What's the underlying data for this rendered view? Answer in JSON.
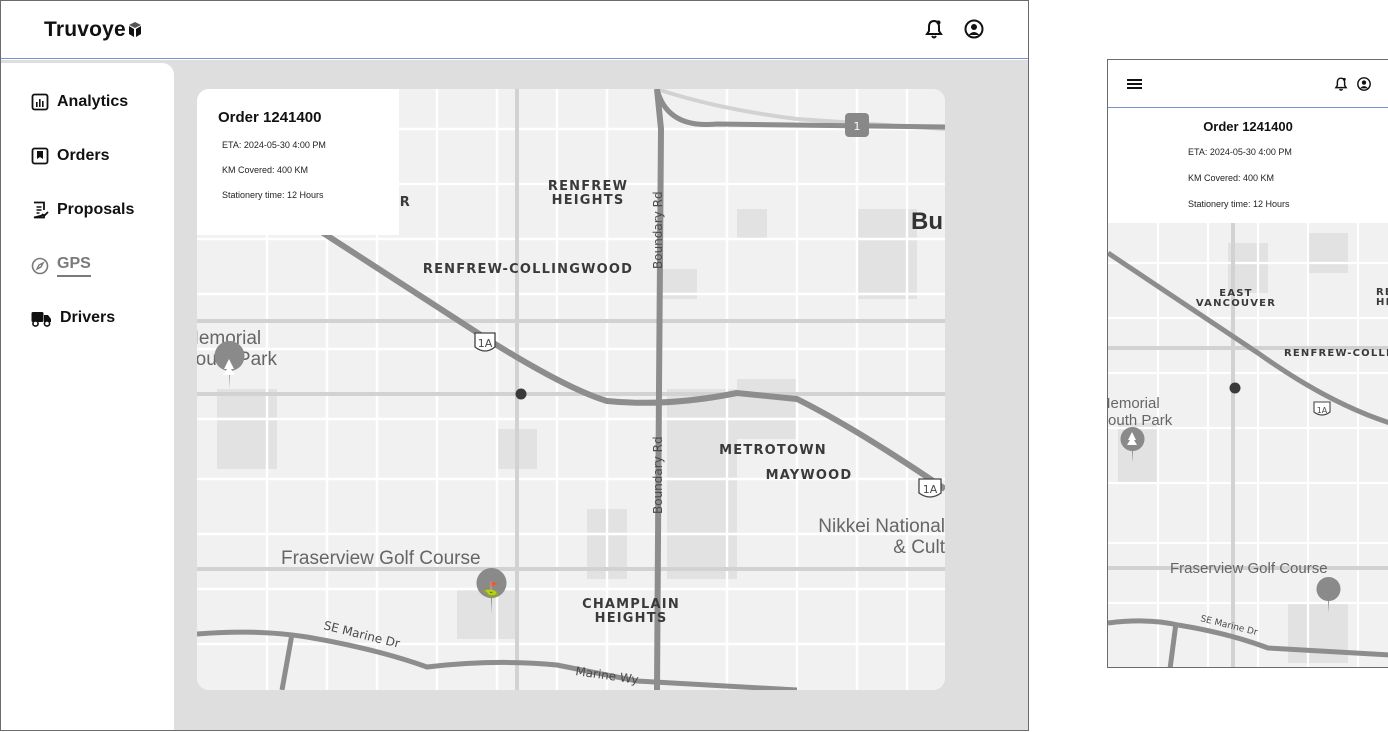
{
  "app": {
    "logo_text": "Truvoye"
  },
  "header": {
    "icons": [
      "bell-icon",
      "user-circle-icon"
    ]
  },
  "sidebar": {
    "items": [
      {
        "label": "Analytics",
        "icon": "bar-chart-icon"
      },
      {
        "label": "Orders",
        "icon": "bookmark-box-icon"
      },
      {
        "label": "Proposals",
        "icon": "document-check-icon"
      },
      {
        "label": "GPS",
        "icon": "compass-icon",
        "active": true
      },
      {
        "label": "Drivers",
        "icon": "truck-icon"
      }
    ]
  },
  "order": {
    "title": "Order 1241400",
    "eta": "ETA: 2024-05-30 4:00 PM",
    "km": "KM Covered: 400 KM",
    "stationery": "Stationery time: 12 Hours"
  },
  "map": {
    "labels": {
      "renfrew_heights_1": "RENFREW",
      "renfrew_heights_2": "HEIGHTS",
      "renfrew_collingwood": "RENFREW-COLLINGWOOD",
      "er_fragment": "ER",
      "memorial_1": "Memorial",
      "memorial_2": "South Park",
      "metrotown": "METROTOWN",
      "maywood": "MAYWOOD",
      "nikkei_1": "Nikkei National",
      "nikkei_2": "& Cult",
      "fraserview": "Fraserview Golf Course",
      "champlain_1": "CHAMPLAIN",
      "champlain_2": "HEIGHTS",
      "boundary_rd": "Boundary Rd",
      "se_marine": "SE Marine Dr",
      "marine_wy": "Marine Wy",
      "burnaby_fragment": "Bu",
      "hwy_1a": "1A",
      "hwy_1": "1"
    }
  },
  "mobile": {
    "order_title": "Order 1241400",
    "eta": "ETA: 2024-05-30 4:00 PM",
    "km": "KM Covered: 400 KM",
    "stationery": "Stationery time: 12 Hours",
    "map_labels": {
      "east_1": "EAST",
      "east_2": "VANCOUVER",
      "renfrew_frag_1": "RE",
      "renfrew_frag_2": "HE",
      "renfrew_collin": "RENFREW-COLLIN",
      "memorial_1": "Memorial",
      "memorial_2": "South Park",
      "fraserview": "Fraserview Golf Course",
      "se_marine": "SE Marine Dr",
      "hwy_1a": "1A"
    }
  }
}
